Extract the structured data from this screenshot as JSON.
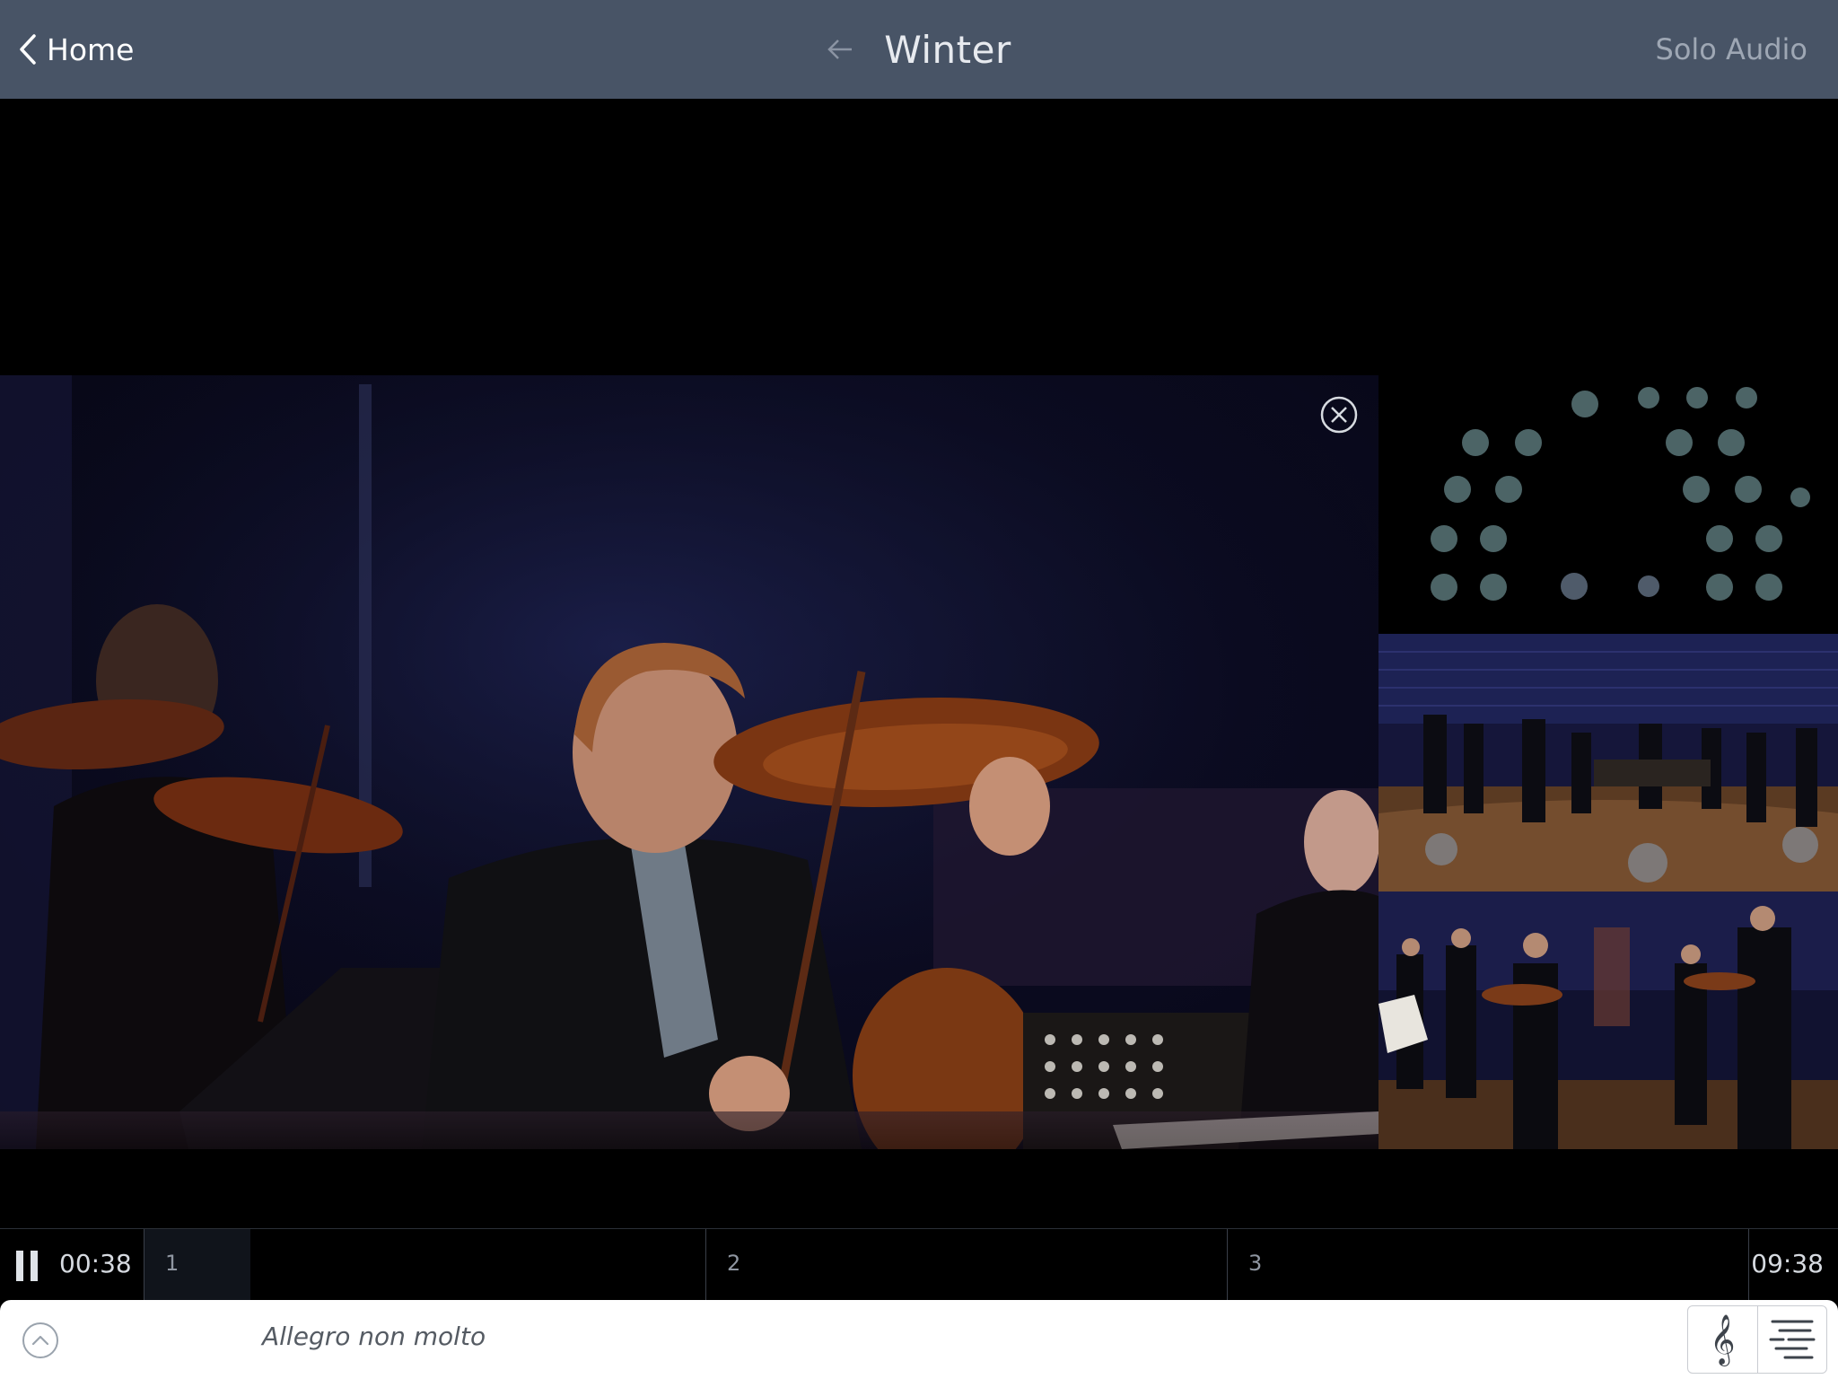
{
  "header": {
    "back_label": "Home",
    "title": "Winter",
    "right_action": "Solo Audio"
  },
  "player": {
    "elapsed": "00:38",
    "duration": "09:38",
    "progress": 0.066,
    "movements": [
      {
        "label": "1",
        "start": 0.0
      },
      {
        "label": "2",
        "start": 0.35
      },
      {
        "label": "3",
        "start": 0.675
      }
    ]
  },
  "info": {
    "tempo": "Allegro non molto"
  },
  "icons": {
    "back": "chevron-left-icon",
    "title_back": "arrow-left-icon",
    "close": "close-circle-icon",
    "pause": "pause-icon",
    "expand": "chevron-up-circle-icon",
    "score": "treble-clef-icon",
    "score_lines": "score-lines-icon"
  },
  "colors": {
    "header_bg": "#485466",
    "player_bg": "#000000",
    "orchestra_dot": "#4c6466",
    "orchestra_dot_alt": "#4f5b6a"
  }
}
